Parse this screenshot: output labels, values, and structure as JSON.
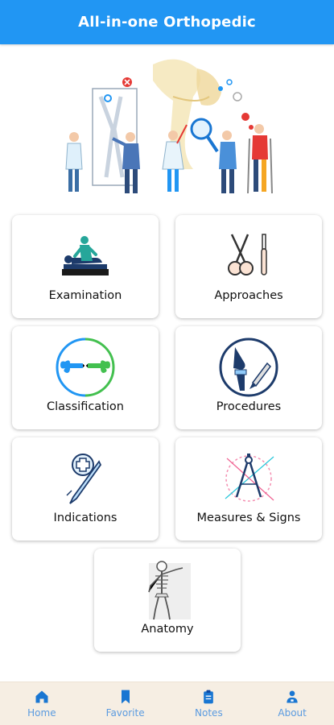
{
  "app_bar": {
    "title": "All-in-one Orthopedic"
  },
  "colors": {
    "primary": "#2196f3",
    "nav_icon": "#1976d2",
    "nav_label": "#5b9be0",
    "nav_background": "#f6eee3"
  },
  "hero": {
    "icon": "orthopedic-team-illustration"
  },
  "menu": {
    "examination": {
      "label": "Examination",
      "icon": "physical-examination-icon"
    },
    "approaches": {
      "label": "Approaches",
      "icon": "scissors-scalpel-icon"
    },
    "classification": {
      "label": "Classification",
      "icon": "bone-fracture-icon"
    },
    "procedures": {
      "label": "Procedures",
      "icon": "knee-implant-icon"
    },
    "indications": {
      "label": "Indications",
      "icon": "scalpel-medical-cross-icon"
    },
    "measures": {
      "label": "Measures & Signs",
      "icon": "compass-icon"
    },
    "anatomy": {
      "label": "Anatomy",
      "icon": "skeleton-icon"
    }
  },
  "bottom_nav": {
    "home": {
      "label": "Home",
      "icon": "home-icon"
    },
    "favorite": {
      "label": "Favorite",
      "icon": "bookmark-icon"
    },
    "notes": {
      "label": "Notes",
      "icon": "clipboard-icon"
    },
    "about": {
      "label": "About",
      "icon": "user-badge-icon"
    }
  }
}
